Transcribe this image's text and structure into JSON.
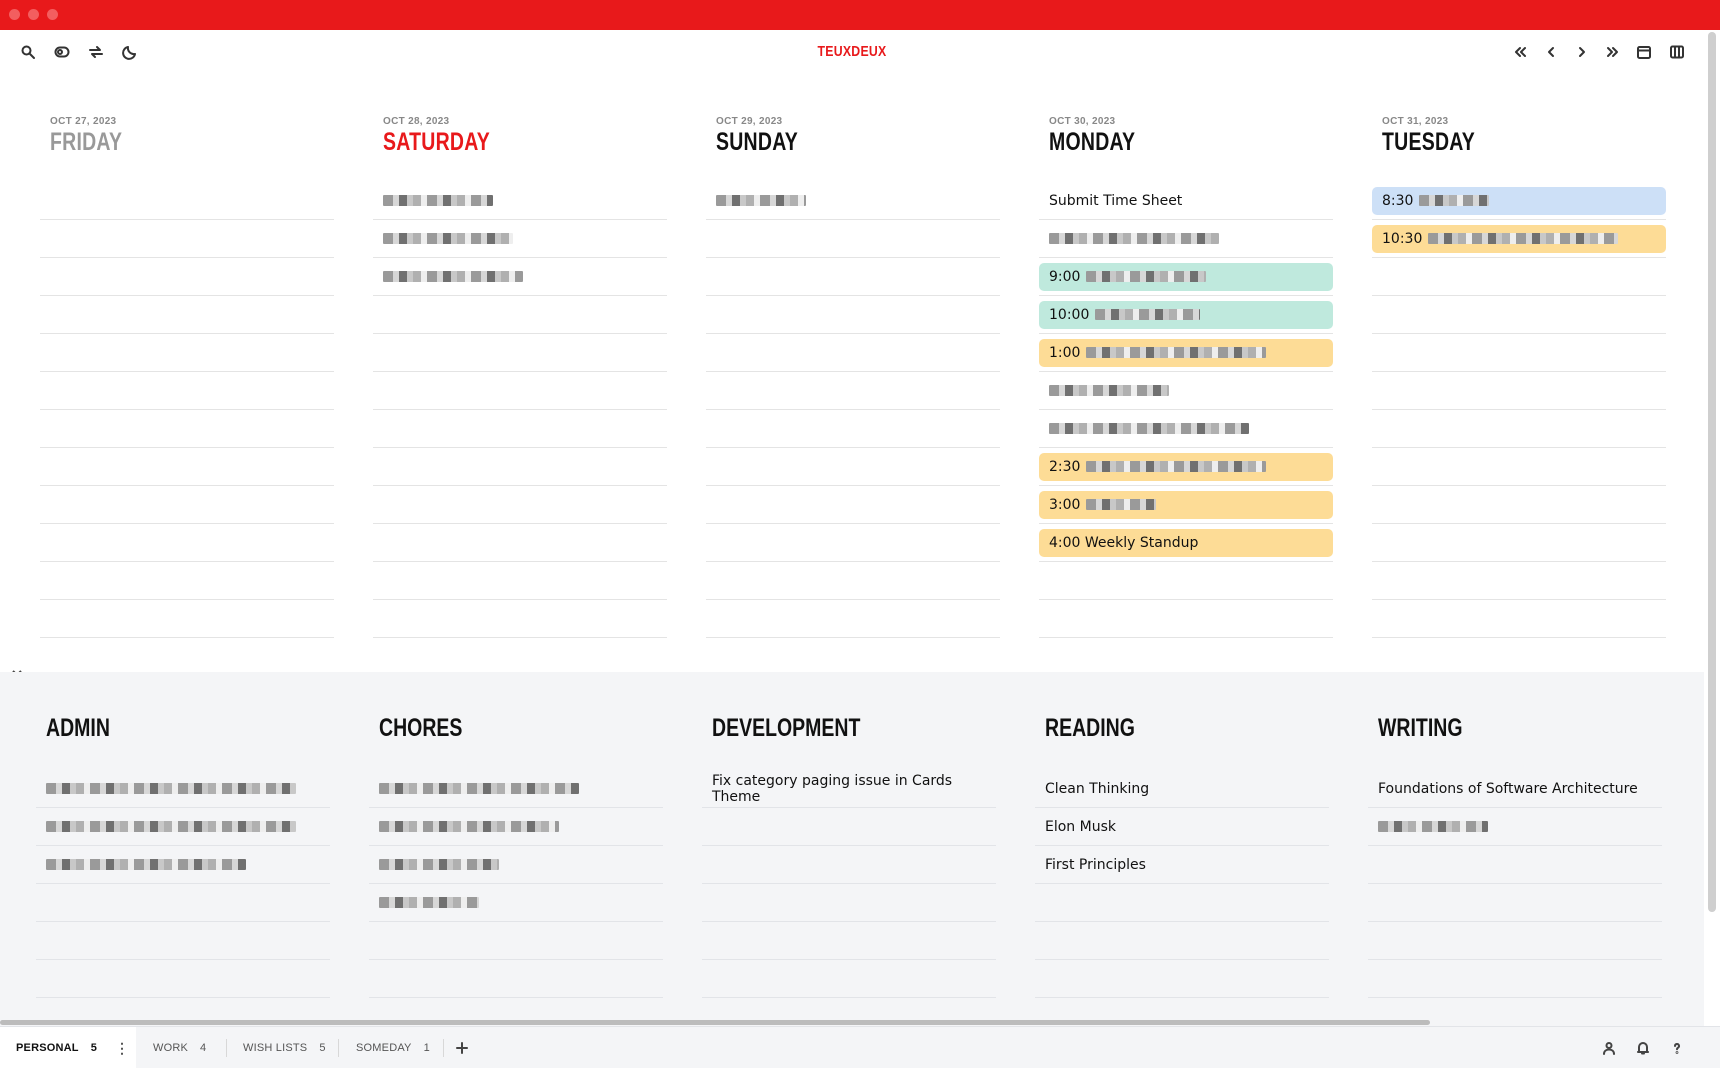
{
  "app": {
    "title": "TEUXDEUX"
  },
  "days": [
    {
      "date": "OCT 27, 2023",
      "name": "FRIDAY",
      "state": "past",
      "todos": []
    },
    {
      "date": "OCT 28, 2023",
      "name": "SATURDAY",
      "state": "today",
      "todos": [
        {
          "text": "",
          "redacted": 110,
          "style": "plain"
        },
        {
          "text": "",
          "redacted": 130,
          "style": "plain"
        },
        {
          "text": "",
          "redacted": 140,
          "style": "plain"
        }
      ]
    },
    {
      "date": "OCT 29, 2023",
      "name": "SUNDAY",
      "state": "future",
      "todos": [
        {
          "text": "",
          "redacted": 90,
          "style": "plain"
        }
      ]
    },
    {
      "date": "OCT 30, 2023",
      "name": "MONDAY",
      "state": "future",
      "todos": [
        {
          "text": "Submit Time Sheet",
          "redacted": 0,
          "style": "plain"
        },
        {
          "text": "",
          "redacted": 170,
          "style": "plain"
        },
        {
          "text": "9:00",
          "redacted": 120,
          "style": "green"
        },
        {
          "text": "10:00",
          "redacted": 105,
          "style": "green"
        },
        {
          "text": "1:00",
          "redacted": 180,
          "style": "yellow"
        },
        {
          "text": "",
          "redacted": 120,
          "style": "plain"
        },
        {
          "text": "",
          "redacted": 200,
          "style": "plain"
        },
        {
          "text": "2:30",
          "redacted": 180,
          "style": "yellow"
        },
        {
          "text": "3:00",
          "redacted": 70,
          "style": "yellow"
        },
        {
          "text": "4:00 Weekly Standup",
          "redacted": 0,
          "style": "yellow"
        }
      ]
    },
    {
      "date": "OCT 31, 2023",
      "name": "TUESDAY",
      "state": "future",
      "todos": [
        {
          "text": "8:30",
          "redacted": 70,
          "style": "blue"
        },
        {
          "text": "10:30",
          "redacted": 190,
          "style": "yellow"
        }
      ]
    }
  ],
  "lists": [
    {
      "name": "ADMIN",
      "items": [
        {
          "text": "",
          "redacted": 250
        },
        {
          "text": "",
          "redacted": 250
        },
        {
          "text": "",
          "redacted": 200
        }
      ]
    },
    {
      "name": "CHORES",
      "items": [
        {
          "text": "",
          "redacted": 200
        },
        {
          "text": "",
          "redacted": 180
        },
        {
          "text": "",
          "redacted": 120
        },
        {
          "text": "",
          "redacted": 100
        }
      ]
    },
    {
      "name": "DEVELOPMENT",
      "items": [
        {
          "text": "Fix category paging issue in Cards Theme",
          "redacted": 0
        }
      ]
    },
    {
      "name": "READING",
      "items": [
        {
          "text": "Clean Thinking",
          "redacted": 0
        },
        {
          "text": "Elon Musk",
          "redacted": 0
        },
        {
          "text": "First Principles",
          "redacted": 0
        }
      ]
    },
    {
      "name": "WRITING",
      "items": [
        {
          "text": "Foundations of Software Architecture",
          "redacted": 0
        },
        {
          "text": "",
          "redacted": 110
        }
      ]
    }
  ],
  "tabs": [
    {
      "label": "PERSONAL",
      "count": "5",
      "active": true
    },
    {
      "label": "WORK",
      "count": "4",
      "active": false
    },
    {
      "label": "WISH LISTS",
      "count": "5",
      "active": false
    },
    {
      "label": "SOMEDAY",
      "count": "1",
      "active": false
    }
  ],
  "colors": {
    "brand": "#e8191b",
    "green": "#bfe9dd",
    "yellow": "#fddc96",
    "blue": "#cde0f7"
  },
  "icons": [
    "search-icon",
    "toggle-icon",
    "repeat-icon",
    "moon-icon",
    "first-page-icon",
    "prev-icon",
    "next-icon",
    "last-page-icon",
    "calendar-icon",
    "columns-icon",
    "more-icon",
    "add-icon",
    "user-icon",
    "bell-icon",
    "help-icon",
    "chevron-down-icon"
  ]
}
